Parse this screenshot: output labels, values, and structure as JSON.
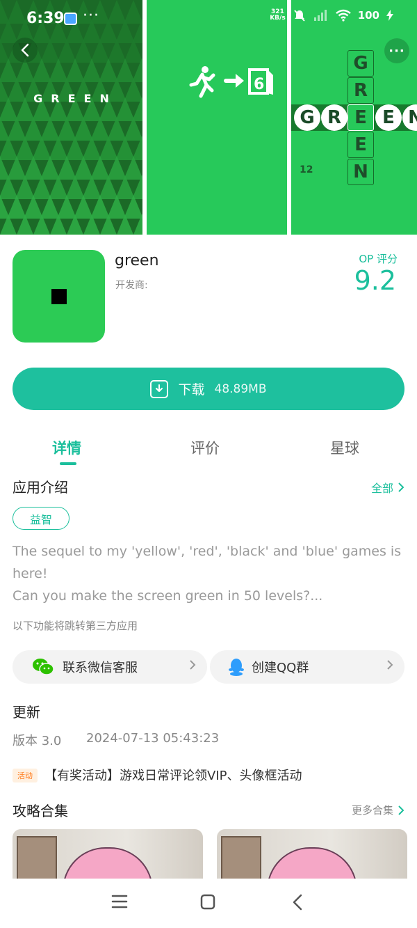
{
  "status_bar": {
    "time": "6:39",
    "more": "···",
    "net_speed_value": "321",
    "net_speed_unit": "KB/s",
    "battery": "100"
  },
  "screenshots": {
    "shot1_title": "GREEN",
    "shot2_level": "6",
    "shot3_letters_vertical": [
      "G",
      "R",
      "E",
      "E",
      "N"
    ],
    "shot3_letters_horizontal": [
      "G",
      "R",
      "E",
      "E",
      "N"
    ],
    "shot3_level": "12"
  },
  "app": {
    "name": "green",
    "developer_label": "开发商:",
    "score_label": "OP 评分",
    "score": "9.2"
  },
  "download": {
    "label": "下载",
    "size": "48.89MB"
  },
  "tabs": [
    {
      "label": "详情",
      "active": true
    },
    {
      "label": "评价",
      "active": false
    },
    {
      "label": "星球",
      "active": false
    }
  ],
  "intro": {
    "title": "应用介绍",
    "see_all": "全部",
    "tag": "益智",
    "description_line1": "The sequel to my 'yellow', 'red', 'black' and 'blue' games is",
    "description_line2": "here!",
    "description_line3": "Can you make the screen green in 50 levels?...",
    "third_party_note": "以下功能将跳转第三方应用"
  },
  "services": {
    "wechat_label": "联系微信客服",
    "qq_label": "创建QQ群"
  },
  "update": {
    "title": "更新",
    "version": "版本 3.0",
    "date": "2024-07-13 05:43:23"
  },
  "event": {
    "badge": "活动",
    "text": "【有奖活动】游戏日常评论领VIP、头像框活动"
  },
  "guides": {
    "title": "攻略合集",
    "more": "更多合集"
  },
  "colors": {
    "accent": "#1bbf9c",
    "game_green": "#27c95a",
    "forest_green": "#1f7a2d"
  }
}
